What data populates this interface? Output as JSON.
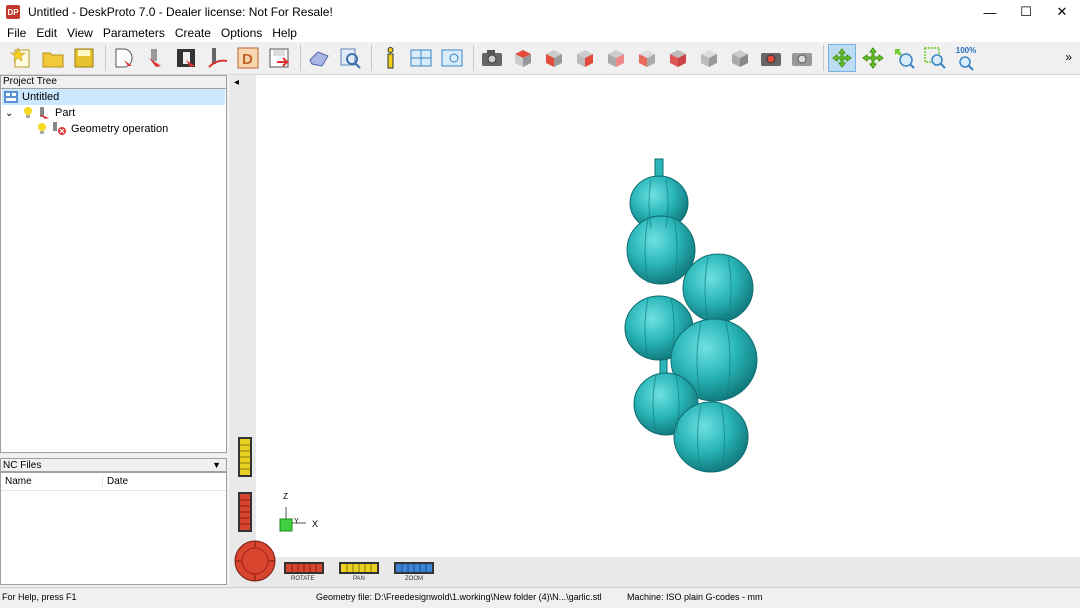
{
  "window": {
    "app_icon_text": "DP",
    "title": "Untitled - DeskProto 7.0 - Dealer license: Not For Resale!",
    "minimize": "—",
    "maximize": "☐",
    "close": "✕"
  },
  "menu": [
    "File",
    "Edit",
    "View",
    "Parameters",
    "Create",
    "Options",
    "Help"
  ],
  "toolbar": {
    "zoom_label": "100%",
    "overflow": "»"
  },
  "project_tree": {
    "header": "Project Tree",
    "root": "Untitled",
    "part": "Part",
    "operation": "Geometry operation"
  },
  "nc_files": {
    "header": "NC Files",
    "col_name": "Name",
    "col_date": "Date"
  },
  "viewport": {
    "axis_z": "Z",
    "axis_y": "Y",
    "axis_x": "X",
    "collapse_arrow": "◂",
    "rotate_label": "ROTATE",
    "pan_label": "PAN",
    "zoom_label": "ZOOM",
    "model_color": "#2ab6b8"
  },
  "status": {
    "help": "For Help, press F1",
    "geometry_file": "Geometry file: D:\\Freedesignwold\\1.working\\New folder (4)\\N...\\garlic.stl",
    "machine": "Machine: ISO plain G-codes - mm"
  }
}
